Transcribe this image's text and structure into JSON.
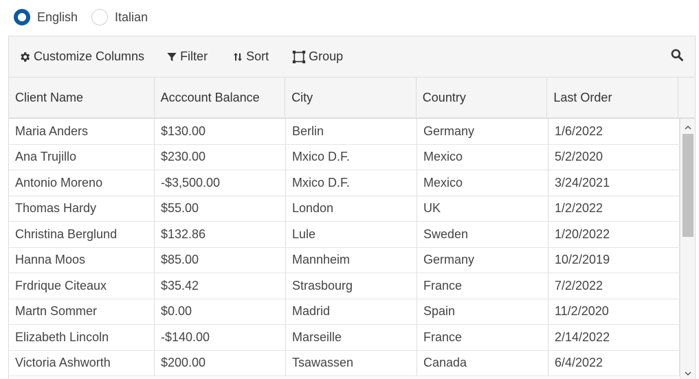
{
  "language": {
    "options": [
      {
        "label": "English",
        "checked": true
      },
      {
        "label": "Italian",
        "checked": false
      }
    ]
  },
  "toolbar": {
    "customize_label": "Customize Columns",
    "filter_label": "Filter",
    "sort_label": "Sort",
    "group_label": "Group",
    "icons": [
      "gear-icon",
      "filter-icon",
      "sort-icon",
      "group-icon",
      "search-icon"
    ]
  },
  "grid": {
    "columns": [
      "Client Name",
      "Acccount Balance",
      "City",
      "Country",
      "Last Order"
    ],
    "rows": [
      [
        "Maria Anders",
        "$130.00",
        "Berlin",
        "Germany",
        "1/6/2022"
      ],
      [
        "Ana Trujillo",
        "$230.00",
        "Mxico D.F.",
        "Mexico",
        "5/2/2020"
      ],
      [
        "Antonio Moreno",
        "-$3,500.00",
        "Mxico D.F.",
        "Mexico",
        "3/24/2021"
      ],
      [
        "Thomas Hardy",
        "$55.00",
        "London",
        "UK",
        "1/2/2022"
      ],
      [
        "Christina Berglund",
        "$132.86",
        "Lule",
        "Sweden",
        "1/20/2022"
      ],
      [
        "Hanna Moos",
        "$85.00",
        "Mannheim",
        "Germany",
        "10/2/2019"
      ],
      [
        "Frdrique Citeaux",
        "$35.42",
        "Strasbourg",
        "France",
        "7/2/2022"
      ],
      [
        "Martn Sommer",
        "$0.00",
        "Madrid",
        "Spain",
        "11/2/2020"
      ],
      [
        "Elizabeth Lincoln",
        "-$140.00",
        "Marseille",
        "France",
        "2/14/2022"
      ],
      [
        "Victoria Ashworth",
        "$200.00",
        "Tsawassen",
        "Canada",
        "6/4/2022"
      ]
    ]
  },
  "colors": {
    "accent": "#0c5a9e",
    "toolbar_bg": "#f5f5f5",
    "border": "#dddddd"
  }
}
